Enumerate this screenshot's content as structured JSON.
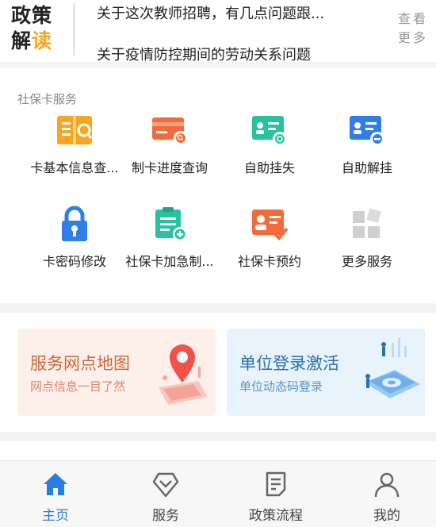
{
  "policy": {
    "logo_line1": "政策",
    "logo_line2_a": "解",
    "logo_line2_b": "读",
    "headline_1": "关于这次教师招聘，有几点问题跟...",
    "headline_2": "关于疫情防控期间的劳动关系问题",
    "more_line1": "查看",
    "more_line2": "更多"
  },
  "services": {
    "title": "社保卡服务",
    "items": [
      {
        "label": "卡基本信息查...",
        "icon": "book-icon"
      },
      {
        "label": "制卡进度查询",
        "icon": "card-search-icon"
      },
      {
        "label": "自助挂失",
        "icon": "card-lock-icon"
      },
      {
        "label": "自助解挂",
        "icon": "card-minus-icon"
      },
      {
        "label": "卡密码修改",
        "icon": "padlock-icon"
      },
      {
        "label": "社保卡加急制...",
        "icon": "clipboard-plus-icon"
      },
      {
        "label": "社保卡预约",
        "icon": "id-check-icon"
      },
      {
        "label": "更多服务",
        "icon": "grid-icon"
      }
    ]
  },
  "banners": {
    "left": {
      "title": "服务网点地图",
      "subtitle": "网点信息一目了然"
    },
    "right": {
      "title": "单位登录激活",
      "subtitle": "单位动态码登录"
    }
  },
  "tabbar": {
    "tabs": [
      {
        "label": "主页",
        "icon": "home-icon",
        "active": true
      },
      {
        "label": "服务",
        "icon": "diamond-icon",
        "active": false
      },
      {
        "label": "政策流程",
        "icon": "document-icon",
        "active": false
      },
      {
        "label": "我的",
        "icon": "user-icon",
        "active": false
      }
    ]
  },
  "colors": {
    "accent": "#2b7de0",
    "orange": "#f5a623",
    "green": "#27c3a0",
    "blue": "#2f7fe6"
  }
}
